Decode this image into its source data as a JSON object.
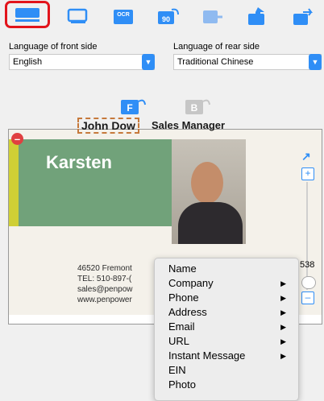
{
  "toolbar": {
    "buttons": [
      {
        "icon": "scan-icon",
        "active": true
      },
      {
        "icon": "window-icon",
        "active": false
      },
      {
        "icon": "ocr-icon",
        "label": "OCR",
        "active": false
      },
      {
        "icon": "rotate-90-icon",
        "label": "90",
        "active": false
      },
      {
        "icon": "export-icon",
        "active": false
      },
      {
        "icon": "upload-icon",
        "active": false
      },
      {
        "icon": "share-icon",
        "active": false
      }
    ]
  },
  "front": {
    "label": "Language of front side",
    "value": "English"
  },
  "rear": {
    "label": "Language of rear side",
    "value": "Traditional Chinese"
  },
  "side_buttons": {
    "front": "F",
    "back": "B"
  },
  "card": {
    "headline": "Karsten",
    "name": "John Dow",
    "title": "Sales Manager",
    "address_line": "46520 Fremont",
    "phone_line": "TEL: 510-897-(",
    "email_line": "sales@penpow",
    "web_line": "www.penpower"
  },
  "zoom_readout": "538",
  "context_menu": [
    {
      "label": "Name",
      "submenu": false
    },
    {
      "label": "Company",
      "submenu": true
    },
    {
      "label": "Phone",
      "submenu": true
    },
    {
      "label": "Address",
      "submenu": true
    },
    {
      "label": "Email",
      "submenu": true
    },
    {
      "label": "URL",
      "submenu": true
    },
    {
      "label": "Instant Message",
      "submenu": true
    },
    {
      "label": "EIN",
      "submenu": false
    },
    {
      "label": "Photo",
      "submenu": false
    }
  ],
  "colors": {
    "accent": "#2f8ef6",
    "active_outline": "#e2141b"
  }
}
